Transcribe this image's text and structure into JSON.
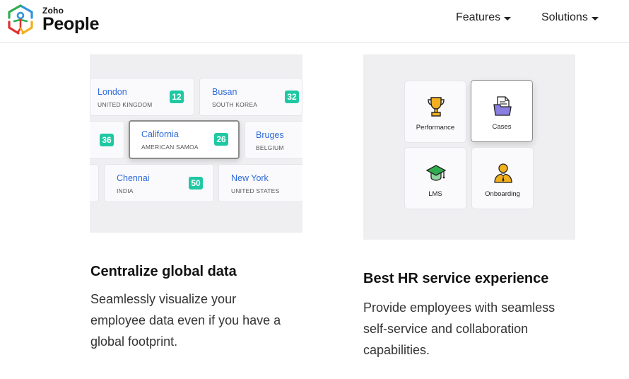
{
  "header": {
    "logo_small": "Zoho",
    "logo_big": "People",
    "nav": [
      {
        "label": "Features"
      },
      {
        "label": "Solutions"
      }
    ]
  },
  "left_card": {
    "cities": [
      {
        "name": "London",
        "country": "UNITED KINGDOM",
        "count": "12"
      },
      {
        "name": "Busan",
        "country": "SOUTH KOREA",
        "count": "32"
      },
      {
        "name": "",
        "country": "",
        "count": "36"
      },
      {
        "name": "California",
        "country": "AMERICAN SAMOA",
        "count": "26"
      },
      {
        "name": "Bruges",
        "country": "BELGIUM",
        "count": ""
      },
      {
        "name": "Chennai",
        "country": "INDIA",
        "count": "50"
      },
      {
        "name": "New York",
        "country": "UNITED STATES",
        "count": ""
      }
    ],
    "title": "Centralize global data",
    "description": "Seamlessly visualize your employee data even if you have a global footprint."
  },
  "right_card": {
    "tiles": [
      {
        "label": "Performance",
        "icon": "trophy-icon"
      },
      {
        "label": "Cases",
        "icon": "document-folder-icon"
      },
      {
        "label": "LMS",
        "icon": "graduation-cap-icon"
      },
      {
        "label": "Onboarding",
        "icon": "employee-icon"
      }
    ],
    "title": "Best HR service experience",
    "description": "Provide employees with seamless self-service and collaboration capabilities."
  },
  "colors": {
    "city_name": "#2f6ad8",
    "badge": "#1fc8a2",
    "panel_bg": "#efeff1"
  }
}
